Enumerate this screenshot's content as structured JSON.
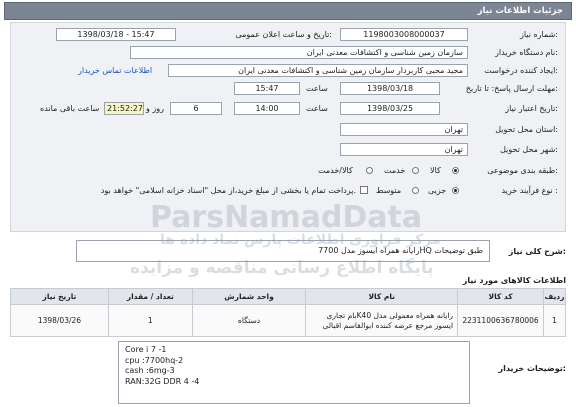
{
  "header": {
    "title": "جزئیات اطلاعات نیاز"
  },
  "fields": {
    "need_number_label": "شماره نیاز:",
    "need_number": "1198003008000037",
    "announce_label": "تاریخ و ساعت اعلان عمومی:",
    "announce_value": "1398/03/18 - 15:47",
    "buyer_org_label": "نام دستگاه خریدار:",
    "buyer_org": "سازمان زمین شناسی و اکتشافات معدنی ایران",
    "creator_label": "ایجاد کننده درخواست:",
    "creator": "مجید محبی کاربردار سازمان زمین شناسی و اکتشافات معدنی ایران",
    "contact_link": "اطلاعات تماس خریدار",
    "deadline_label": "مهلت ارسال پاسخ: تا تاریخ:",
    "deadline_date": "1398/03/18",
    "deadline_time_label": "ساعت",
    "deadline_time": "15:47",
    "validity_label": "تاریخ اعتبار نیاز:",
    "validity_date": "1398/03/25",
    "validity_time_label": "ساعت",
    "validity_time": "14:00",
    "days_value": "6",
    "days_label": "روز و",
    "remaining_time": "21:52:27",
    "remaining_label": "ساعت باقی مانده",
    "province_label": "استان محل تحویل:",
    "province": "تهران",
    "city_label": "شهر محل تحویل:",
    "city": "تهران",
    "category_label": "طبقه بندی موضوعی:",
    "category_options": [
      "کالا",
      "خدمت",
      "کالا/خدمت"
    ],
    "process_label": "نوع فرآیند خرید :",
    "process_options": [
      "جزیی",
      "متوسط"
    ],
    "payment_note": "پرداخت تمام یا بخشی از مبلغ خرید،از محل \"اسناد خزانه اسلامی\" خواهد بود."
  },
  "need_summary": {
    "label": "شرح کلی نیاز:",
    "value": "رایانه همراه ایسوز مدل 7700HQ طبق توضیحات"
  },
  "items": {
    "section_title": "اطلاعات کالاهای مورد نیاز",
    "columns": [
      "ردیف",
      "کد کالا",
      "نام کالا",
      "واحد شمارش",
      "تعداد / مقدار",
      "تاریخ نیاز"
    ],
    "rows": [
      {
        "row": "1",
        "code": "2231100636780006",
        "name": "رایانه همراه معمولی مدل K40بام تجاری ایسوز مرجع عرضه کننده ابوالقاسم اقبالی",
        "unit": "دستگاه",
        "qty": "1",
        "date": "1398/03/26"
      }
    ]
  },
  "buyer_notes": {
    "label": "توضیحات خریدار:",
    "lines": [
      "Core i 7 -1",
      "cpu :7700hq-2",
      "cash :6mg-3",
      "RAN:32G DDR 4 -4"
    ]
  },
  "watermarks": {
    "main": "ParsNamadData",
    "sub": "مرکز فراوری اطلاعات پارس نماد داده ها",
    "portal": "پایگاه اطلاع رسانی مناقصه و مزایده"
  }
}
